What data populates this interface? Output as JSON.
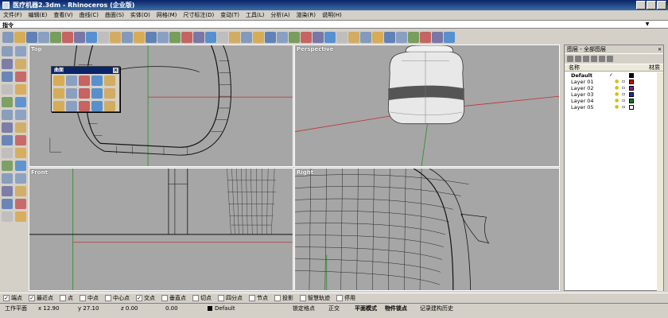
{
  "window": {
    "title": "医疗机器2.3dm - Rhinoceros (企业版)"
  },
  "menu": [
    "文件(F)",
    "编辑(E)",
    "查看(V)",
    "曲线(C)",
    "曲面(S)",
    "实体(O)",
    "网格(M)",
    "尺寸标注(D)",
    "变动(T)",
    "工具(L)",
    "分析(A)",
    "渲染(R)",
    "说明(H)"
  ],
  "command": {
    "label": "指令"
  },
  "viewports": {
    "top": {
      "label": "Top"
    },
    "perspective": {
      "label": "Perspective"
    },
    "front": {
      "label": "Front"
    },
    "right": {
      "label": "Right"
    }
  },
  "floating_palette": {
    "title": "曲面"
  },
  "layers": {
    "title": "图层 - 全部图层",
    "col_name": "名称",
    "col_material": "材质",
    "rows": [
      {
        "name": "Default",
        "current": true,
        "color": "#000000"
      },
      {
        "name": "Layer 01",
        "current": false,
        "color": "#cc0000"
      },
      {
        "name": "Layer 02",
        "current": false,
        "color": "#8b1a8b"
      },
      {
        "name": "Layer 03",
        "current": false,
        "color": "#1c2fa0"
      },
      {
        "name": "Layer 04",
        "current": false,
        "color": "#0e7a1c"
      },
      {
        "name": "Layer 05",
        "current": false,
        "color": "#ffffff"
      }
    ],
    "current_mark": "✓"
  },
  "osnaps": [
    {
      "label": "端点",
      "checked": true
    },
    {
      "label": "最近点",
      "checked": true
    },
    {
      "label": "点",
      "checked": false
    },
    {
      "label": "中点",
      "checked": false
    },
    {
      "label": "中心点",
      "checked": false
    },
    {
      "label": "交点",
      "checked": true
    },
    {
      "label": "垂直点",
      "checked": false
    },
    {
      "label": "切点",
      "checked": false
    },
    {
      "label": "四分点",
      "checked": false
    },
    {
      "label": "节点",
      "checked": false
    },
    {
      "label": "投影",
      "checked": false
    },
    {
      "label": "智慧轨迹",
      "checked": false
    },
    {
      "label": "停用",
      "checked": false
    }
  ],
  "status": {
    "cplane": "工作平面",
    "x": "x 12.90",
    "y": "y 27.10",
    "z": "z 0.00",
    "extra": "0.00",
    "layer": "Default",
    "grid_snap": "锁定格点",
    "ortho": "正交",
    "planar": "平面模式",
    "osnap": "物件锁点",
    "history": "记录建构历史"
  },
  "icon_colors": [
    "#6a88b8",
    "#d8a030",
    "#3a68b0",
    "#7090c0",
    "#5a8c3a",
    "#c04040",
    "#5a5a9a",
    "#2d7bd0",
    "#b8b8b8",
    "#d0a040"
  ]
}
